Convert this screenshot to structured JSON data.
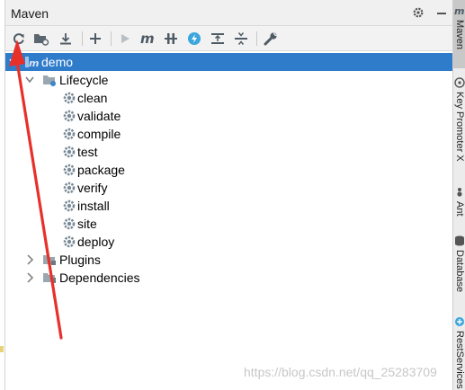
{
  "panel": {
    "title": "Maven"
  },
  "toolbar": {
    "buttons": [
      {
        "name": "reimport-icon"
      },
      {
        "name": "generate-sources-icon"
      },
      {
        "name": "download-icon"
      },
      {
        "name": "add-maven-project-icon"
      },
      {
        "name": "run-icon"
      },
      {
        "name": "execute-goal-icon"
      },
      {
        "name": "toggle-offline-icon"
      },
      {
        "name": "skip-tests-icon"
      },
      {
        "name": "show-dependencies-icon"
      },
      {
        "name": "collapse-all-icon"
      },
      {
        "name": "settings-wrench-icon"
      }
    ]
  },
  "tree": {
    "project": "demo",
    "lifecycle": {
      "label": "Lifecycle",
      "items": [
        "clean",
        "validate",
        "compile",
        "test",
        "package",
        "verify",
        "install",
        "site",
        "deploy"
      ]
    },
    "plugins": "Plugins",
    "dependencies": "Dependencies"
  },
  "right_tools": [
    {
      "label": "Maven",
      "active": true
    },
    {
      "label": "Key Promoter X"
    },
    {
      "label": "Ant"
    },
    {
      "label": "Database"
    },
    {
      "label": "RestServices"
    }
  ],
  "watermark": "https://blog.csdn.net/qq_25283709",
  "colors": {
    "selection": "#2f7ccb",
    "annotation_arrow": "#e8302a",
    "lifecycle_gear": "#7a8a97"
  }
}
